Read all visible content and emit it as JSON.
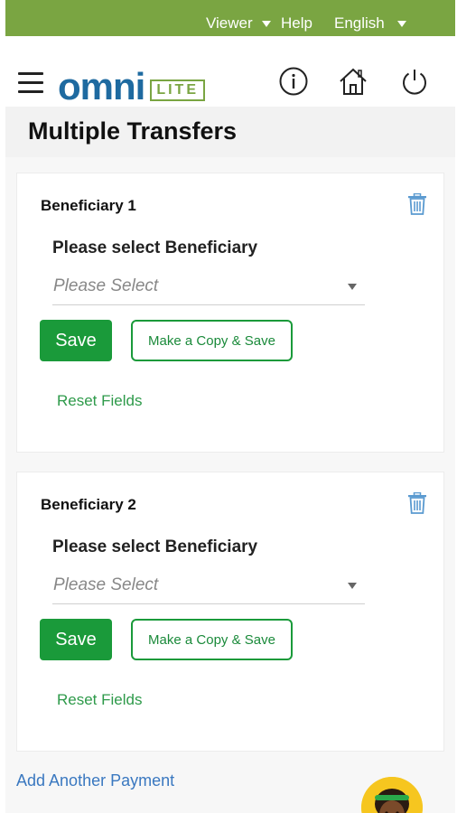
{
  "topbar": {
    "viewer_label": "Viewer",
    "help_label": "Help",
    "language_label": "English"
  },
  "header": {
    "logo_text": "omni",
    "logo_badge": "LITE",
    "icons": [
      "hamburger-menu-icon",
      "info-icon",
      "home-icon",
      "power-icon"
    ]
  },
  "page": {
    "title": "Multiple Transfers"
  },
  "beneficiaries": [
    {
      "title": "Beneficiary 1",
      "field_label": "Please select Beneficiary",
      "select_placeholder": "Please Select",
      "save_label": "Save",
      "copy_save_label": "Make a Copy & Save",
      "reset_label": "Reset Fields"
    },
    {
      "title": "Beneficiary 2",
      "field_label": "Please select Beneficiary",
      "select_placeholder": "Please Select",
      "save_label": "Save",
      "copy_save_label": "Make a Copy & Save",
      "reset_label": "Reset Fields"
    }
  ],
  "footer": {
    "add_payment_label": "Add Another Payment"
  },
  "colors": {
    "brand_green": "#7aa542",
    "button_green": "#1a9a3a",
    "logo_blue": "#1e6aa0",
    "link_blue": "#3a78c0",
    "trash_blue": "#5a9ad0"
  }
}
